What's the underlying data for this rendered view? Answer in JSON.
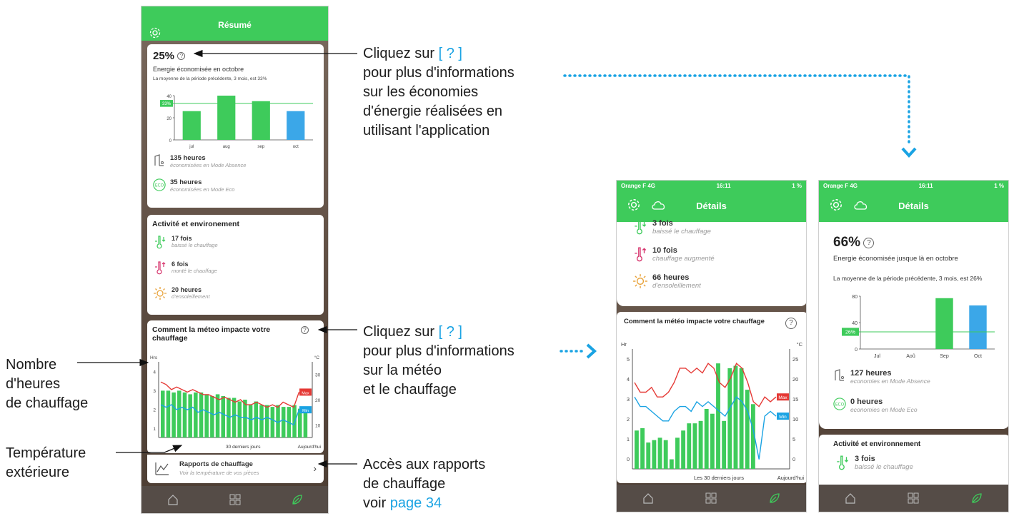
{
  "phone1": {
    "title": "Résumé",
    "savings": {
      "percent": "25%",
      "label": "Energie économisée en octobre",
      "note": "La moyenne de la période précédente, 3 mois, est 33%",
      "chart_data": {
        "type": "bar",
        "categories": [
          "jul",
          "aug",
          "sep",
          "oct"
        ],
        "values": [
          26,
          40,
          35,
          26
        ],
        "avg_label": "33%",
        "avg_value": 33,
        "ylim": [
          0,
          40
        ],
        "yticks": [
          "40",
          "20",
          "0"
        ],
        "colors": [
          "#3ecb5b",
          "#3ecb5b",
          "#3ecb5b",
          "#3ba7e8"
        ]
      },
      "absence_hours": "135 heures",
      "absence_label": "économisées en Mode Absence",
      "eco_hours": "35 heures",
      "eco_label": "économisées en Mode Eco"
    },
    "activity": {
      "title": "Activité et environement",
      "items": [
        {
          "value": "17 fois",
          "label": "baissé le chauffage",
          "icon": "thermometer-down-icon"
        },
        {
          "value": "6 fois",
          "label": "monté le chauffage",
          "icon": "thermometer-up-icon"
        },
        {
          "value": "20 heures",
          "label": "d'ensoleillement",
          "icon": "sun-icon"
        }
      ]
    },
    "weather": {
      "title": "Comment la méteo impacte votre chauffage",
      "left_unit": "Hrs",
      "right_unit": "°C",
      "left_ticks": [
        "4",
        "3",
        "2",
        "1"
      ],
      "right_ticks": [
        "30",
        "20",
        "10"
      ],
      "max_label": "Max",
      "min_label": "Min",
      "x_label": "30 derniers jours",
      "x_label_right": "Aujourd'hui"
    },
    "reports": {
      "title": "Rapports de chauffage",
      "subtitle": "Voir la température de vos pièces"
    }
  },
  "phone2": {
    "status": {
      "carrier": "Orange F  4G",
      "time": "16:11",
      "battery": "1 %"
    },
    "title": "Détails",
    "items": [
      {
        "value": "3 fois",
        "label": "baissé le chauffage",
        "icon": "thermometer-down-icon"
      },
      {
        "value": "10 fois",
        "label": "chauffage augmenté",
        "icon": "thermometer-up-icon"
      },
      {
        "value": "66 heures",
        "label": "d'ensoleillement",
        "icon": "sun-icon"
      }
    ],
    "weather": {
      "title": "Comment la météo impacte votre chauffage",
      "left_unit": "Hr",
      "right_unit": "°C",
      "left_ticks": [
        "5",
        "4",
        "3",
        "2",
        "1",
        "0"
      ],
      "right_ticks": [
        "25",
        "20",
        "15",
        "10",
        "5",
        "0"
      ],
      "max_label": "Max",
      "min_label": "Min",
      "x_label": "Les 30 derniers jours",
      "x_label_right": "Aujourd'hui"
    }
  },
  "phone3": {
    "status": {
      "carrier": "Orange F  4G",
      "time": "16:11",
      "battery": "1 %"
    },
    "title": "Détails",
    "savings": {
      "percent": "66%",
      "label": "Energie économisée jusque là en octobre",
      "note": "La moyenne de la période précédente, 3 mois, est 26%",
      "chart_data": {
        "type": "bar",
        "categories": [
          "Jul",
          "Aoû",
          "Sep",
          "Oct"
        ],
        "values": [
          0,
          0,
          77,
          66
        ],
        "avg_label": "26%",
        "avg_value": 26,
        "ylim": [
          0,
          80
        ],
        "yticks": [
          "80",
          "40",
          "0"
        ],
        "colors": [
          "#3ecb5b",
          "#3ecb5b",
          "#3ecb5b",
          "#3ba7e8"
        ]
      },
      "absence_hours": "127 heures",
      "absence_label": "economies en Mode Absence",
      "eco_hours": "0 heures",
      "eco_label": "economies en Mode Eco"
    },
    "activity": {
      "title": "Activité et environnement",
      "items": [
        {
          "value": "3 fois",
          "label": "baissé le chauffage",
          "icon": "thermometer-down-icon"
        }
      ]
    }
  },
  "annotations": {
    "a1_line1_pre": "Cliquez sur ",
    "a1_line1_link": "[ ? ]",
    "a1_rest": [
      "pour plus d'informations",
      "sur les économies",
      "d'énergie réalisées en",
      "utilisant l'application"
    ],
    "a2_line1_pre": "Cliquez sur ",
    "a2_line1_link": "[ ? ]",
    "a2_rest": [
      "pour plus d'informations",
      "sur la météo",
      "et le chauffage"
    ],
    "a3_lines": [
      "Accès aux rapports",
      "de chauffage"
    ],
    "a3_last_pre": "voir ",
    "a3_last_link": "page 34",
    "left1": [
      "Nombre",
      "d'heures",
      "de chauffage"
    ],
    "left2": [
      "Température",
      "extérieure"
    ]
  },
  "colors": {
    "green": "#3ecb5b",
    "blue": "#1aa3e3",
    "red": "#e53935",
    "bar_blue": "#3ba7e8"
  }
}
